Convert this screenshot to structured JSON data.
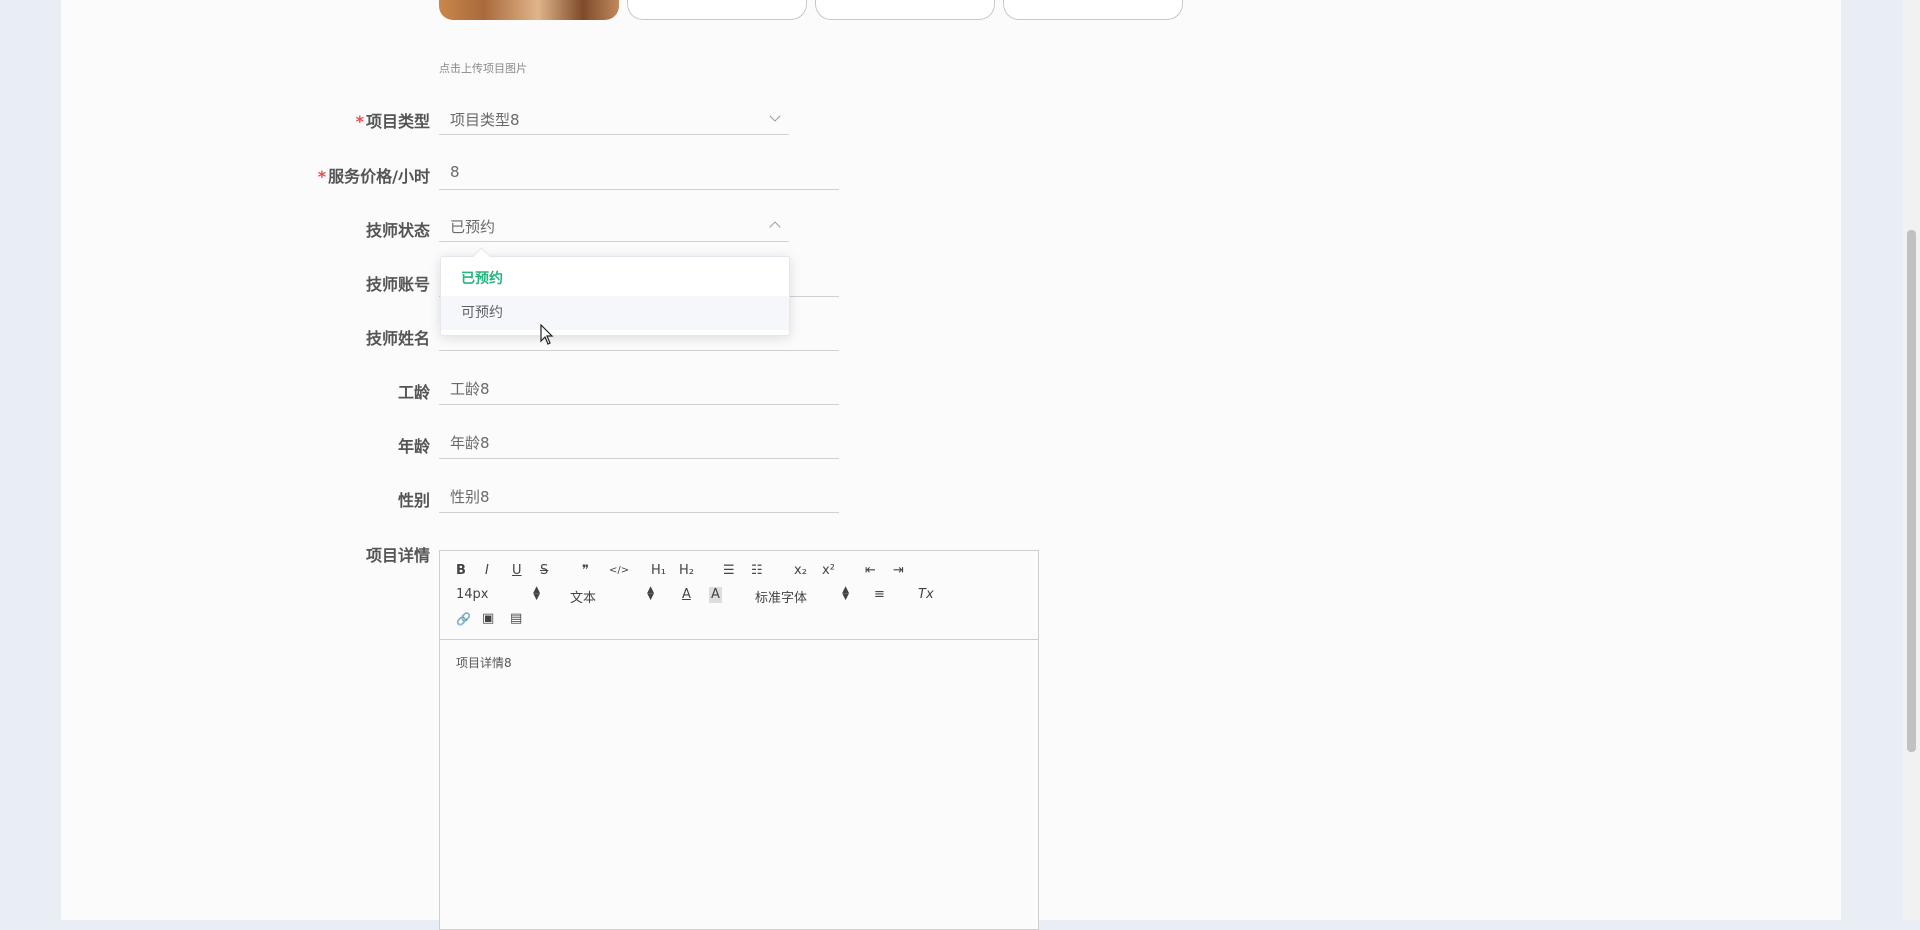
{
  "upload": {
    "hint": "点击上传项目图片"
  },
  "form": {
    "project_type": {
      "label": "项目类型",
      "required": "*",
      "value": "项目类型8"
    },
    "price": {
      "label": "服务价格/小时",
      "required": "*",
      "value": "8"
    },
    "status": {
      "label": "技师状态",
      "value": "已预约",
      "options": [
        "已预约",
        "可预约"
      ]
    },
    "account": {
      "label": "技师账号"
    },
    "name": {
      "label": "技师姓名"
    },
    "seniority": {
      "label": "工龄",
      "value": "工龄8"
    },
    "age": {
      "label": "年龄",
      "value": "年龄8"
    },
    "gender": {
      "label": "性别",
      "value": "性别8"
    },
    "details": {
      "label": "项目详情",
      "content": "项目详情8"
    }
  },
  "editor_toolbar": {
    "bold": "B",
    "italic": "I",
    "underline": "U",
    "strike": "S",
    "quote": "❞",
    "code": "</>",
    "h1": "H₁",
    "h2": "H₂",
    "ordered_list": "☰",
    "bullet_list": "☷",
    "subscript": "x₂",
    "superscript": "x²",
    "outdent": "⇤",
    "indent": "⇥",
    "size_select": "14px",
    "header_select": "文本",
    "font_color": "A",
    "bg_color": "A",
    "font_select": "标准字体",
    "align": "≡",
    "clean": "Tx",
    "link": "🔗",
    "image": "▣",
    "video": "▤"
  }
}
